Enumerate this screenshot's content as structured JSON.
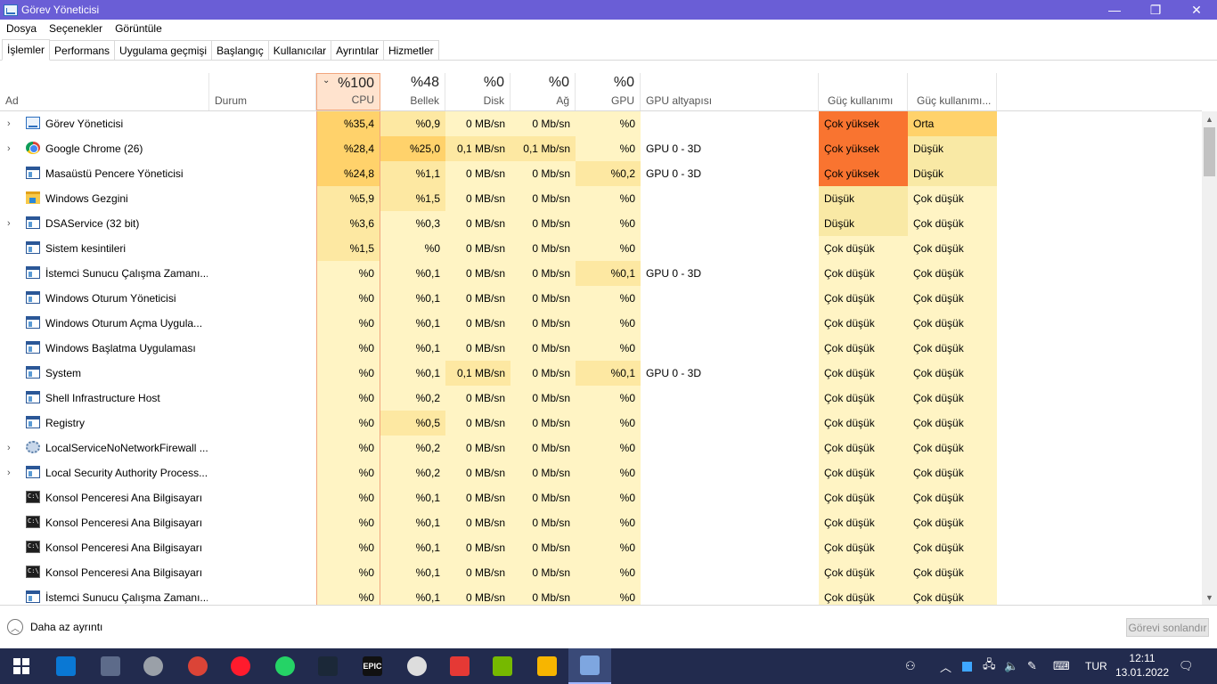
{
  "window": {
    "title": "Görev Yöneticisi",
    "controls": [
      "—",
      "❐",
      "✕"
    ]
  },
  "menu": [
    "Dosya",
    "Seçenekler",
    "Görüntüle"
  ],
  "tabs": [
    "İşlemler",
    "Performans",
    "Uygulama geçmişi",
    "Başlangıç",
    "Kullanıcılar",
    "Ayrıntılar",
    "Hizmetler"
  ],
  "active_tab": "İşlemler",
  "columns": {
    "name": "Ad",
    "status": "Durum",
    "cpu": {
      "pct": "%100",
      "label": "CPU"
    },
    "mem": {
      "pct": "%48",
      "label": "Bellek"
    },
    "disk": {
      "pct": "%0",
      "label": "Disk"
    },
    "net": {
      "pct": "%0",
      "label": "Ağ"
    },
    "gpu": {
      "pct": "%0",
      "label": "GPU"
    },
    "gpu_engine": "GPU altyapısı",
    "power": "Güç kullanımı",
    "power_trend": "Güç kullanımı..."
  },
  "sort_indicator": "⌄",
  "colors": {
    "titlebar": "#6a5ed6",
    "cpu_sorted_header": "#ffe3ce",
    "heat_low": "#fff4c4",
    "heat_mid": "#fde8a2",
    "heat_high": "#ffd26b",
    "power_very_high": "#f97430",
    "power_moderate": "#ffd26b",
    "power_low": "#f9e9a5"
  },
  "processes": [
    {
      "name": "Görev Yöneticisi",
      "icon": "task-manager-icon",
      "expandable": true,
      "status": "",
      "cpu": "%35,4",
      "mem": "%0,9",
      "disk": "0 MB/sn",
      "net": "0 Mb/sn",
      "gpu": "%0",
      "gpu_engine": "",
      "power": "Çok yüksek",
      "power_trend": "Orta"
    },
    {
      "name": "Google Chrome (26)",
      "icon": "chrome-icon",
      "expandable": true,
      "status": "",
      "cpu": "%28,4",
      "mem": "%25,0",
      "disk": "0,1 MB/sn",
      "net": "0,1 Mb/sn",
      "gpu": "%0",
      "gpu_engine": "GPU 0 - 3D",
      "power": "Çok yüksek",
      "power_trend": "Düşük"
    },
    {
      "name": "Masaüstü Pencere Yöneticisi",
      "icon": "window-app-icon",
      "expandable": false,
      "status": "",
      "cpu": "%24,8",
      "mem": "%1,1",
      "disk": "0 MB/sn",
      "net": "0 Mb/sn",
      "gpu": "%0,2",
      "gpu_engine": "GPU 0 - 3D",
      "power": "Çok yüksek",
      "power_trend": "Düşük"
    },
    {
      "name": "Windows Gezgini",
      "icon": "folder-icon",
      "expandable": false,
      "status": "",
      "cpu": "%5,9",
      "mem": "%1,5",
      "disk": "0 MB/sn",
      "net": "0 Mb/sn",
      "gpu": "%0",
      "gpu_engine": "",
      "power": "Düşük",
      "power_trend": "Çok düşük"
    },
    {
      "name": "DSAService (32 bit)",
      "icon": "window-app-icon",
      "expandable": true,
      "status": "",
      "cpu": "%3,6",
      "mem": "%0,3",
      "disk": "0 MB/sn",
      "net": "0 Mb/sn",
      "gpu": "%0",
      "gpu_engine": "",
      "power": "Düşük",
      "power_trend": "Çok düşük"
    },
    {
      "name": "Sistem kesintileri",
      "icon": "window-app-icon",
      "expandable": false,
      "status": "",
      "cpu": "%1,5",
      "mem": "%0",
      "disk": "0 MB/sn",
      "net": "0 Mb/sn",
      "gpu": "%0",
      "gpu_engine": "",
      "power": "Çok düşük",
      "power_trend": "Çok düşük"
    },
    {
      "name": "İstemci Sunucu Çalışma Zamanı...",
      "icon": "window-app-icon",
      "expandable": false,
      "status": "",
      "cpu": "%0",
      "mem": "%0,1",
      "disk": "0 MB/sn",
      "net": "0 Mb/sn",
      "gpu": "%0,1",
      "gpu_engine": "GPU 0 - 3D",
      "power": "Çok düşük",
      "power_trend": "Çok düşük"
    },
    {
      "name": "Windows Oturum Yöneticisi",
      "icon": "window-app-icon",
      "expandable": false,
      "status": "",
      "cpu": "%0",
      "mem": "%0,1",
      "disk": "0 MB/sn",
      "net": "0 Mb/sn",
      "gpu": "%0",
      "gpu_engine": "",
      "power": "Çok düşük",
      "power_trend": "Çok düşük"
    },
    {
      "name": "Windows Oturum Açma Uygula...",
      "icon": "window-app-icon",
      "expandable": false,
      "status": "",
      "cpu": "%0",
      "mem": "%0,1",
      "disk": "0 MB/sn",
      "net": "0 Mb/sn",
      "gpu": "%0",
      "gpu_engine": "",
      "power": "Çok düşük",
      "power_trend": "Çok düşük"
    },
    {
      "name": "Windows Başlatma Uygulaması",
      "icon": "window-app-icon",
      "expandable": false,
      "status": "",
      "cpu": "%0",
      "mem": "%0,1",
      "disk": "0 MB/sn",
      "net": "0 Mb/sn",
      "gpu": "%0",
      "gpu_engine": "",
      "power": "Çok düşük",
      "power_trend": "Çok düşük"
    },
    {
      "name": "System",
      "icon": "window-app-icon",
      "expandable": false,
      "status": "",
      "cpu": "%0",
      "mem": "%0,1",
      "disk": "0,1 MB/sn",
      "net": "0 Mb/sn",
      "gpu": "%0,1",
      "gpu_engine": "GPU 0 - 3D",
      "power": "Çok düşük",
      "power_trend": "Çok düşük"
    },
    {
      "name": "Shell Infrastructure Host",
      "icon": "window-app-icon",
      "expandable": false,
      "status": "",
      "cpu": "%0",
      "mem": "%0,2",
      "disk": "0 MB/sn",
      "net": "0 Mb/sn",
      "gpu": "%0",
      "gpu_engine": "",
      "power": "Çok düşük",
      "power_trend": "Çok düşük"
    },
    {
      "name": "Registry",
      "icon": "window-app-icon",
      "expandable": false,
      "status": "",
      "cpu": "%0",
      "mem": "%0,5",
      "disk": "0 MB/sn",
      "net": "0 Mb/sn",
      "gpu": "%0",
      "gpu_engine": "",
      "power": "Çok düşük",
      "power_trend": "Çok düşük"
    },
    {
      "name": "LocalServiceNoNetworkFirewall ...",
      "icon": "service-gear-icon",
      "expandable": true,
      "status": "",
      "cpu": "%0",
      "mem": "%0,2",
      "disk": "0 MB/sn",
      "net": "0 Mb/sn",
      "gpu": "%0",
      "gpu_engine": "",
      "power": "Çok düşük",
      "power_trend": "Çok düşük"
    },
    {
      "name": "Local Security Authority Process...",
      "icon": "window-app-icon",
      "expandable": true,
      "status": "",
      "cpu": "%0",
      "mem": "%0,2",
      "disk": "0 MB/sn",
      "net": "0 Mb/sn",
      "gpu": "%0",
      "gpu_engine": "",
      "power": "Çok düşük",
      "power_trend": "Çok düşük"
    },
    {
      "name": "Konsol Penceresi Ana Bilgisayarı",
      "icon": "console-icon",
      "expandable": false,
      "status": "",
      "cpu": "%0",
      "mem": "%0,1",
      "disk": "0 MB/sn",
      "net": "0 Mb/sn",
      "gpu": "%0",
      "gpu_engine": "",
      "power": "Çok düşük",
      "power_trend": "Çok düşük"
    },
    {
      "name": "Konsol Penceresi Ana Bilgisayarı",
      "icon": "console-icon",
      "expandable": false,
      "status": "",
      "cpu": "%0",
      "mem": "%0,1",
      "disk": "0 MB/sn",
      "net": "0 Mb/sn",
      "gpu": "%0",
      "gpu_engine": "",
      "power": "Çok düşük",
      "power_trend": "Çok düşük"
    },
    {
      "name": "Konsol Penceresi Ana Bilgisayarı",
      "icon": "console-icon",
      "expandable": false,
      "status": "",
      "cpu": "%0",
      "mem": "%0,1",
      "disk": "0 MB/sn",
      "net": "0 Mb/sn",
      "gpu": "%0",
      "gpu_engine": "",
      "power": "Çok düşük",
      "power_trend": "Çok düşük"
    },
    {
      "name": "Konsol Penceresi Ana Bilgisayarı",
      "icon": "console-icon",
      "expandable": false,
      "status": "",
      "cpu": "%0",
      "mem": "%0,1",
      "disk": "0 MB/sn",
      "net": "0 Mb/sn",
      "gpu": "%0",
      "gpu_engine": "",
      "power": "Çok düşük",
      "power_trend": "Çok düşük"
    },
    {
      "name": "İstemci Sunucu Çalışma Zamanı...",
      "icon": "window-app-icon",
      "expandable": false,
      "status": "",
      "cpu": "%0",
      "mem": "%0,1",
      "disk": "0 MB/sn",
      "net": "0 Mb/sn",
      "gpu": "%0",
      "gpu_engine": "",
      "power": "Çok düşük",
      "power_trend": "Çok düşük"
    }
  ],
  "footer": {
    "fewer_details": "Daha az ayrıntı",
    "end_task": "Görevi sonlandır"
  },
  "taskbar": {
    "apps": [
      {
        "name": "windows-start-icon",
        "glyph": "",
        "color": "#ffffff"
      },
      {
        "name": "microsoft-store-icon",
        "glyph": "",
        "color": "#0a78d4"
      },
      {
        "name": "calculator-icon",
        "glyph": "",
        "color": "#5d6b8a"
      },
      {
        "name": "pro-app-icon",
        "glyph": "",
        "color": "#9aa0a8"
      },
      {
        "name": "chrome-icon",
        "glyph": "",
        "color": "#db4437"
      },
      {
        "name": "opera-icon",
        "glyph": "",
        "color": "#ff1b2d"
      },
      {
        "name": "whatsapp-icon",
        "glyph": "",
        "color": "#25d366"
      },
      {
        "name": "steam-icon",
        "glyph": "",
        "color": "#1b2838"
      },
      {
        "name": "epic-games-icon",
        "glyph": "EPIC",
        "color": "#111111"
      },
      {
        "name": "spiral-app-icon",
        "glyph": "",
        "color": "#dddddd"
      },
      {
        "name": "red-app-icon",
        "glyph": "",
        "color": "#e53935"
      },
      {
        "name": "nvidia-icon",
        "glyph": "",
        "color": "#76b900"
      },
      {
        "name": "bluestacks-icon",
        "glyph": "",
        "color": "#f7b500"
      },
      {
        "name": "task-manager-taskbar-icon",
        "glyph": "",
        "color": "#7ea6e0"
      }
    ],
    "tray": {
      "language": "TUR",
      "time": "12:11",
      "date": "13.01.2022"
    }
  }
}
